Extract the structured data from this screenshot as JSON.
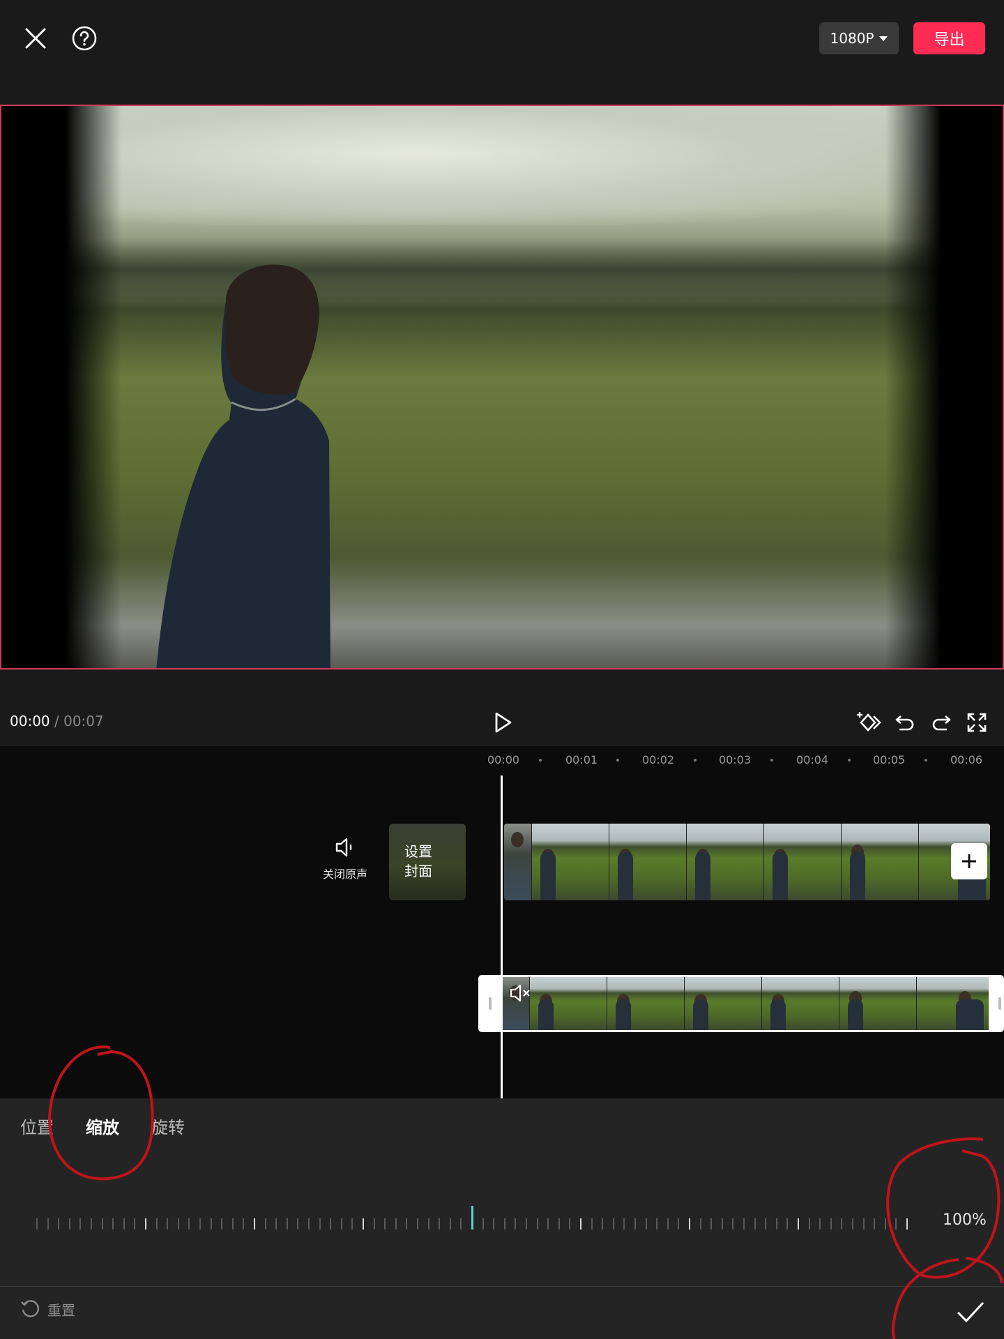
{
  "header": {
    "resolution_label": "1080P",
    "export_label": "导出"
  },
  "playback": {
    "current_time": "00:00",
    "separator": "/",
    "total_time": "00:07"
  },
  "timeline": {
    "ruler_labels": [
      "00:00",
      "00:01",
      "00:02",
      "00:03",
      "00:04",
      "00:05",
      "00:06"
    ],
    "mute_label": "关闭原声",
    "cover_label_line1": "设置",
    "cover_label_line2": "封面"
  },
  "adjust_panel": {
    "tabs": [
      {
        "label": "位置",
        "active": false
      },
      {
        "label": "缩放",
        "active": true
      },
      {
        "label": "旋转",
        "active": false
      }
    ],
    "value_label": "100%",
    "reset_label": "重置"
  },
  "colors": {
    "accent": "#fe2c55",
    "slider_thumb": "#5fd1c9",
    "annotation": "#c0141a"
  },
  "icons": [
    "close-icon",
    "help-icon",
    "play-icon",
    "keyframe-icon",
    "undo-icon",
    "redo-icon",
    "fullscreen-icon",
    "speaker-icon",
    "plus-icon",
    "mute-icon",
    "reset-icon",
    "check-icon"
  ]
}
